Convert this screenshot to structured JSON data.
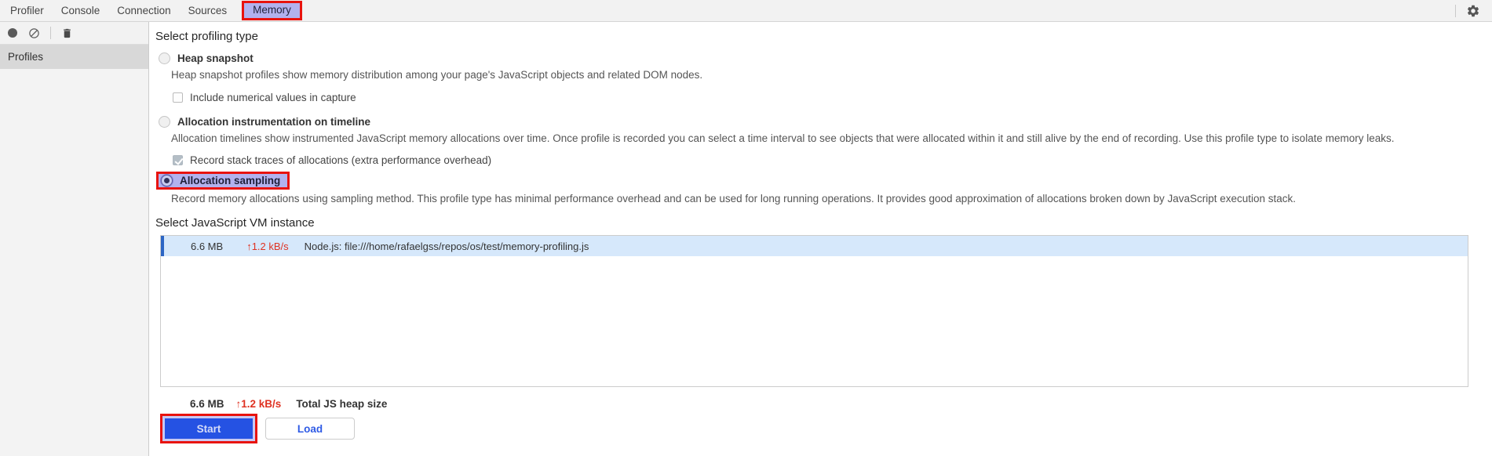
{
  "tabbar": {
    "tabs": [
      {
        "label": "Profiler"
      },
      {
        "label": "Console"
      },
      {
        "label": "Connection"
      },
      {
        "label": "Sources"
      },
      {
        "label": "Memory"
      }
    ],
    "active_tab": "Memory"
  },
  "toolbar": {
    "icons": [
      "record-icon",
      "clear-icon",
      "trash-icon"
    ]
  },
  "sidebar": {
    "items": [
      {
        "label": "Profiles",
        "selected": true
      }
    ]
  },
  "main": {
    "profiling_type": {
      "heading": "Select profiling type",
      "options": [
        {
          "label": "Heap snapshot",
          "selected": false,
          "description": "Heap snapshot profiles show memory distribution among your page's JavaScript objects and related DOM nodes.",
          "checkbox": {
            "label": "Include numerical values in capture",
            "checked": false
          }
        },
        {
          "label": "Allocation instrumentation on timeline",
          "selected": false,
          "description": "Allocation timelines show instrumented JavaScript memory allocations over time. Once profile is recorded you can select a time interval to see objects that were allocated within it and still alive by the end of recording. Use this profile type to isolate memory leaks.",
          "checkbox": {
            "label": "Record stack traces of allocations (extra performance overhead)",
            "checked": true
          }
        },
        {
          "label": "Allocation sampling",
          "selected": true,
          "annotated": true,
          "description": "Record memory allocations using sampling method. This profile type has minimal performance overhead and can be used for long running operations. It provides good approximation of allocations broken down by JavaScript execution stack."
        }
      ]
    },
    "vm_instance": {
      "heading": "Select JavaScript VM instance",
      "rows": [
        {
          "size": "6.6 MB",
          "rate": "↑1.2 kB/s",
          "name": "Node.js: file:///home/rafaelgss/repos/os/test/memory-profiling.js",
          "selected": true
        }
      ]
    },
    "footer": {
      "size": "6.6 MB",
      "rate": "↑1.2 kB/s",
      "label": "Total JS heap size"
    },
    "buttons": {
      "start": "Start",
      "load": "Load"
    }
  },
  "colors": {
    "annotation_red": "#e8130e",
    "highlight_lavender": "#b2b2ee",
    "start_button_blue": "#2552e3",
    "load_label_blue": "#2f5be5",
    "rate_red": "#df3222",
    "selected_row_blue": "#d6e8fb",
    "row_marker_blue": "#2c65c4"
  }
}
